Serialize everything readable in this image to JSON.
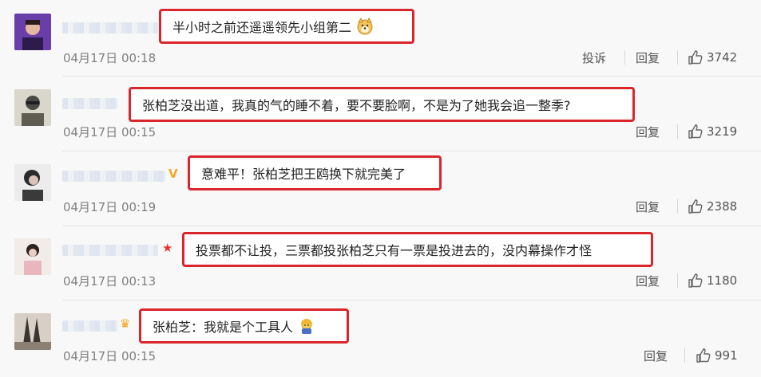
{
  "labels": {
    "report": "投诉",
    "reply": "回复"
  },
  "comments": [
    {
      "text": "半小时之前还遥遥领先小组第二",
      "time": "04月17日 00:18",
      "likes": "3742",
      "has_report": true
    },
    {
      "text": "张柏芝没出道，我真的气的睡不着，要不要脸啊，不是为了她我会追一整季?",
      "time": "04月17日 00:15",
      "likes": "3219",
      "has_report": false
    },
    {
      "text": "意难平！张柏芝把王鸥换下就完美了",
      "time": "04月17日 00:19",
      "likes": "2388",
      "has_report": false
    },
    {
      "text": "投票都不让投，三票都投张柏芝只有一票是投进去的，没内幕操作才怪",
      "time": "04月17日 00:13",
      "likes": "1180",
      "has_report": false
    },
    {
      "text": "张柏芝：我就是个工具人",
      "time": "04月17日 00:15",
      "likes": "991",
      "has_report": false
    }
  ]
}
